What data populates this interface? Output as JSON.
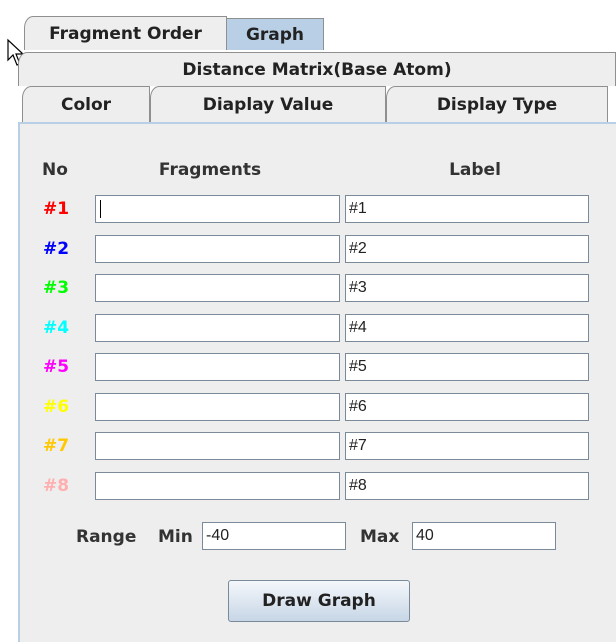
{
  "tabs": {
    "row1": [
      {
        "label": "Fragment Order"
      },
      {
        "label": "Graph"
      }
    ],
    "row2": [
      {
        "label": "Distance Matrix(Base Atom)"
      }
    ],
    "row3": [
      {
        "label": "Color"
      },
      {
        "label": "Diaplay Value"
      },
      {
        "label": "Display Type"
      }
    ],
    "selected": "Graph"
  },
  "table": {
    "headers": {
      "no": "No",
      "fragments": "Fragments",
      "label": "Label"
    },
    "rows": [
      {
        "no": "#1",
        "color": "#ff0000",
        "fragment": "",
        "label": "#1"
      },
      {
        "no": "#2",
        "color": "#0000ff",
        "fragment": "",
        "label": "#2"
      },
      {
        "no": "#3",
        "color": "#00ff00",
        "fragment": "",
        "label": "#3"
      },
      {
        "no": "#4",
        "color": "#00ffff",
        "fragment": "",
        "label": "#4"
      },
      {
        "no": "#5",
        "color": "#ff00ff",
        "fragment": "",
        "label": "#5"
      },
      {
        "no": "#6",
        "color": "#ffff00",
        "fragment": "",
        "label": "#6"
      },
      {
        "no": "#7",
        "color": "#ffc800",
        "fragment": "",
        "label": "#7"
      },
      {
        "no": "#8",
        "color": "#ffafaf",
        "fragment": "",
        "label": "#8"
      }
    ]
  },
  "range": {
    "label": "Range",
    "min_label": "Min",
    "min_value": "-40",
    "max_label": "Max",
    "max_value": "40"
  },
  "draw_button": {
    "label": "Draw Graph"
  },
  "icons": {
    "cursor": "mouse-pointer-icon"
  }
}
